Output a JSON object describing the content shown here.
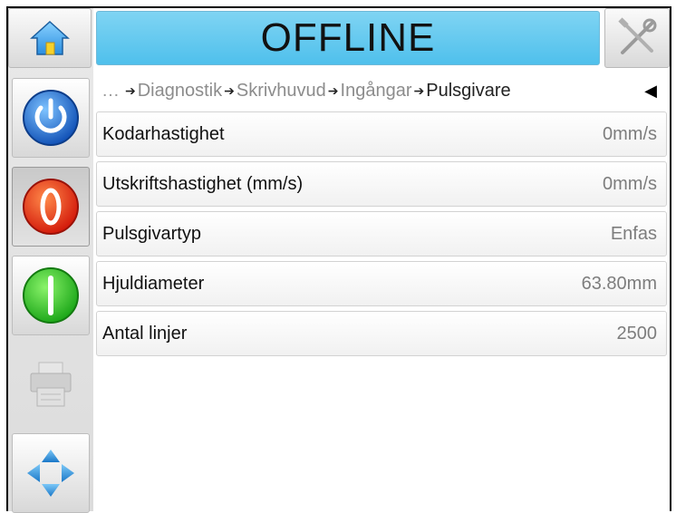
{
  "header": {
    "status": "OFFLINE",
    "status_color": "#55c3ee"
  },
  "breadcrumb": {
    "ellipsis": "…",
    "items": [
      "Diagnostik",
      "Skrivhuvud",
      "Ingångar",
      "Pulsgivare"
    ],
    "arrow": "➔"
  },
  "sidebar": {
    "buttons": [
      "power-icon",
      "stop-icon",
      "start-icon",
      "printer-icon",
      "navigation-arrows-icon"
    ]
  },
  "list": {
    "rows": [
      {
        "label": "Kodarhastighet",
        "value": "0mm/s"
      },
      {
        "label": "Utskriftshastighet (mm/s)",
        "value": "0mm/s"
      },
      {
        "label": "Pulsgivartyp",
        "value": "Enfas"
      },
      {
        "label": "Hjuldiameter",
        "value": "63.80mm"
      },
      {
        "label": "Antal linjer",
        "value": "2500"
      }
    ]
  }
}
